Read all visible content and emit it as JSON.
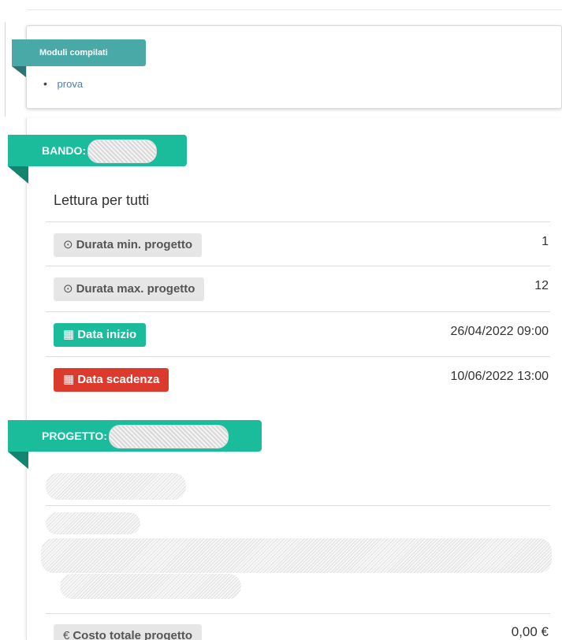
{
  "moduli": {
    "title": "Moduli compilati",
    "items": [
      {
        "label": "prova"
      }
    ]
  },
  "bando": {
    "ribbon_label": "BANDO:",
    "subtitle": "Lettura per tutti",
    "rows": [
      {
        "label": "Durata min. progetto",
        "icon": "clock-icon",
        "glyph": "⊙",
        "value": "1",
        "color": "grey"
      },
      {
        "label": "Durata max. progetto",
        "icon": "clock-icon",
        "glyph": "⊙",
        "value": "12",
        "color": "grey"
      },
      {
        "label": "Data inizio",
        "icon": "calendar-icon",
        "glyph": "▦",
        "value": "26/04/2022 09:00",
        "color": "#1abc9c"
      },
      {
        "label": "Data scadenza",
        "icon": "calendar-icon",
        "glyph": "▦",
        "value": "10/06/2022 13:00",
        "color": "#dd3a2e"
      }
    ]
  },
  "progetto": {
    "ribbon_label": "PROGETTO:",
    "cost_label": "Costo totale progetto",
    "cost_icon": "euro-icon",
    "cost_glyph": "€",
    "cost_value": "0,00 €"
  },
  "colors": {
    "ribbon_green": "#1abc9c",
    "moduli_teal": "#49a9a6",
    "danger_red": "#dd3a2e",
    "link_blue": "#4a7eb8"
  }
}
